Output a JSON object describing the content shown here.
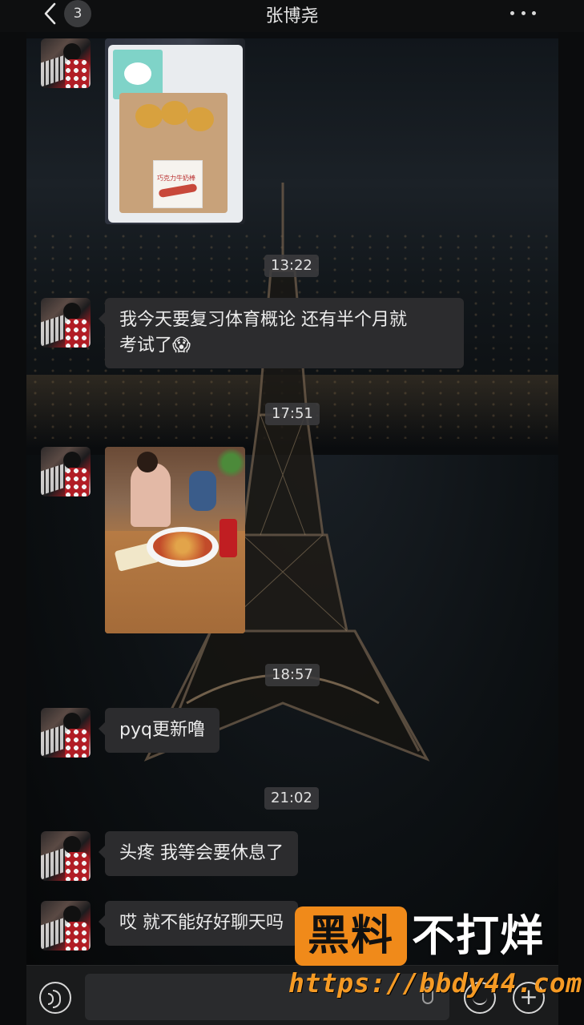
{
  "header": {
    "unread_count": "3",
    "title": "张博尧"
  },
  "messages": [
    {
      "type": "image",
      "description_icon": "bread-bag-photo"
    },
    {
      "type": "time",
      "text": "13:22"
    },
    {
      "type": "text",
      "line1": "我今天要复习体育概论 还有半个月就",
      "line2": "考试了😱"
    },
    {
      "type": "time",
      "text": "17:51"
    },
    {
      "type": "image",
      "description_icon": "restaurant-photo"
    },
    {
      "type": "time",
      "text": "18:57"
    },
    {
      "type": "text",
      "text": "pyq更新噜"
    },
    {
      "type": "time",
      "text": "21:02"
    },
    {
      "type": "text",
      "text": "头疼 我等会要休息了"
    },
    {
      "type": "text",
      "text": "哎 就不能好好聊天吗"
    }
  ],
  "photo_labels": {
    "bag_label": "巧克力牛奶棒"
  },
  "input_bar": {
    "voice_icon": "voice-icon",
    "emoji_icon": "emoji-icon",
    "plus_icon": "plus-icon",
    "plus_glyph": "+"
  },
  "watermark": {
    "badge": "黑料",
    "text": "不打烊",
    "url": "https://bbdy44.com",
    "color": "#f08a1a"
  }
}
